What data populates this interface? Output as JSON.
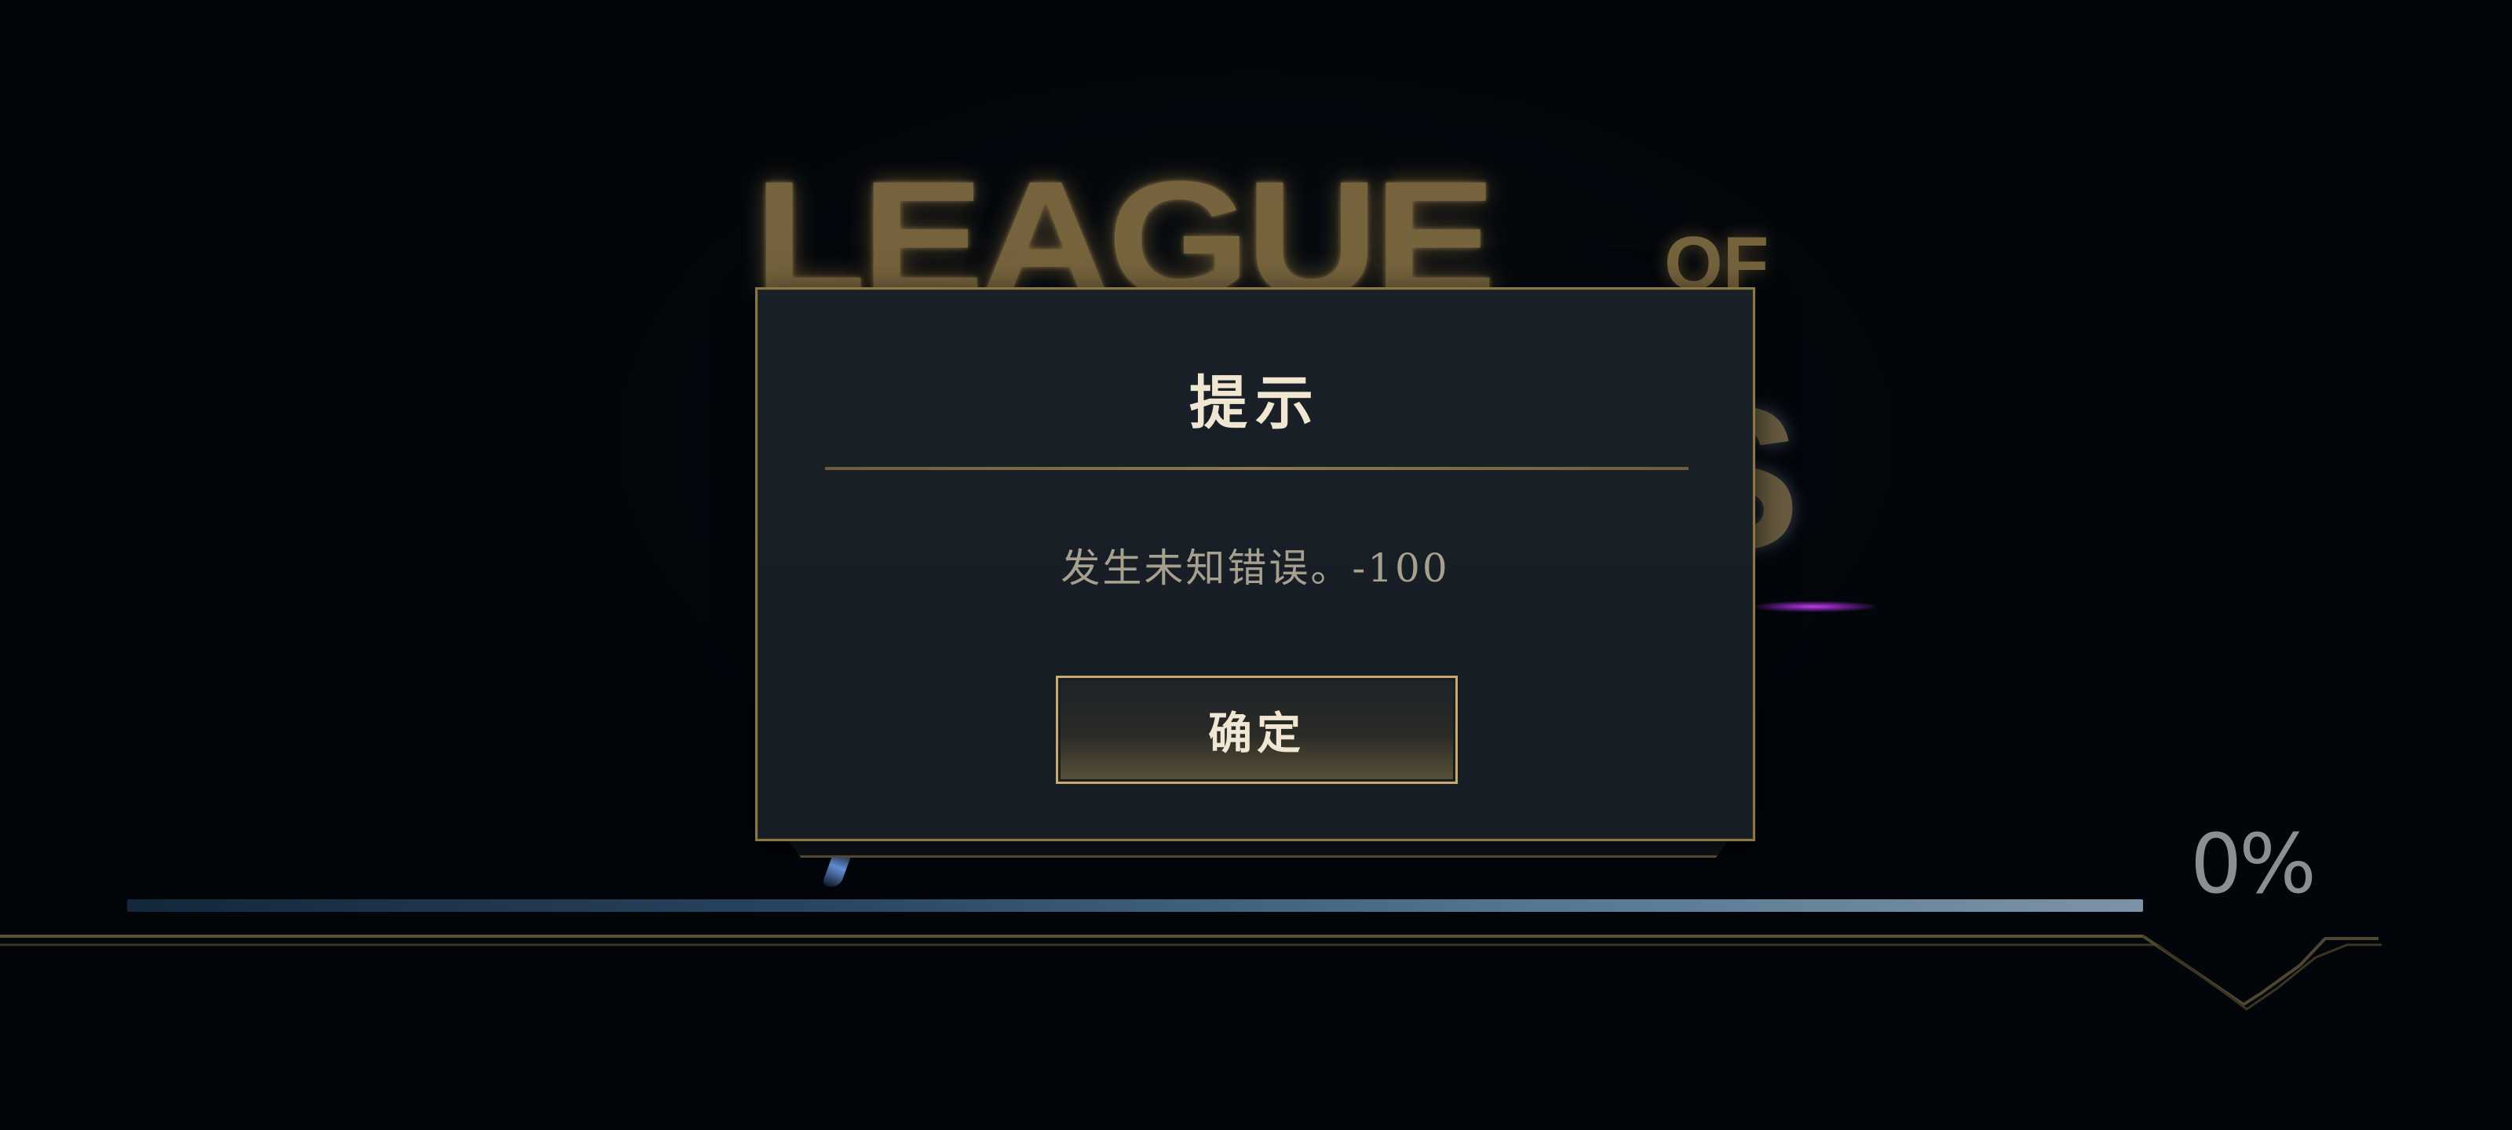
{
  "background": {
    "logo_line1": "LEAGUE",
    "logo_of": "OF",
    "logo_fragment": "S"
  },
  "dialog": {
    "title": "提示",
    "message": "发生未知错误。-100",
    "confirm_label": "确定"
  },
  "loading": {
    "progress_fraction": 0.0,
    "percent_text": "0%"
  },
  "colors": {
    "gold_border": "#8a7746",
    "gold_bright": "#c8aa6e",
    "title_text": "#f0e6d2",
    "message_text": "#a7a08e",
    "background": "#03070c"
  }
}
